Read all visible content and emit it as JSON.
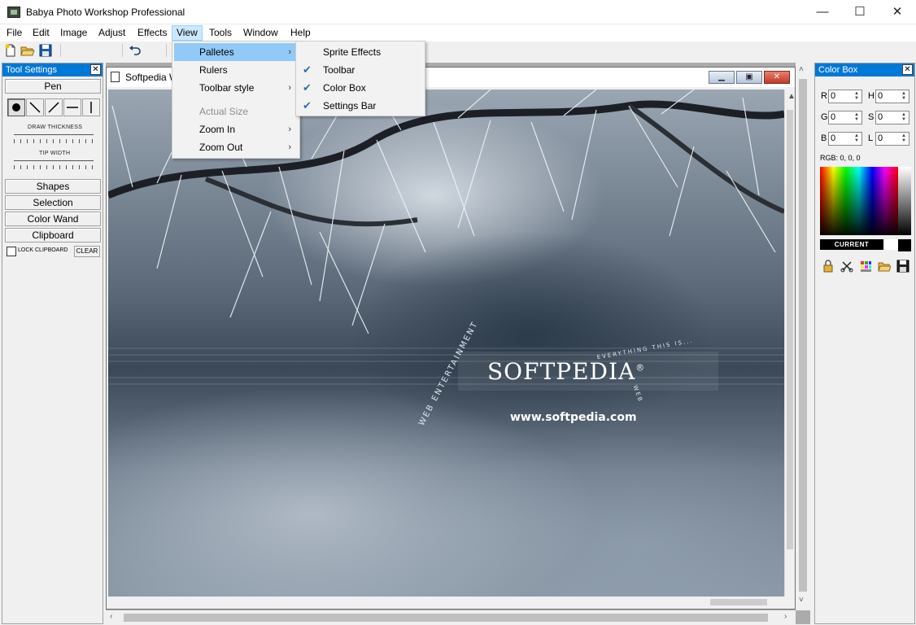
{
  "window": {
    "title": "Babya Photo Workshop Professional",
    "min": "—",
    "max": "☐",
    "close": "✕"
  },
  "menubar": [
    "File",
    "Edit",
    "Image",
    "Adjust",
    "Effects",
    "View",
    "Tools",
    "Window",
    "Help"
  ],
  "view_menu": {
    "items": [
      {
        "label": "Palletes",
        "submenu": true,
        "highlighted": true,
        "disabled": false
      },
      {
        "label": "Rulers",
        "submenu": false,
        "highlighted": false,
        "disabled": false
      },
      {
        "label": "Toolbar style",
        "submenu": true,
        "highlighted": false,
        "disabled": false
      },
      {
        "label": "Actual Size",
        "submenu": false,
        "highlighted": false,
        "disabled": true
      },
      {
        "label": "Zoom In",
        "submenu": true,
        "highlighted": false,
        "disabled": false
      },
      {
        "label": "Zoom Out",
        "submenu": true,
        "highlighted": false,
        "disabled": false
      }
    ],
    "arrow": "›"
  },
  "palletes_submenu": {
    "items": [
      {
        "label": "Sprite Effects",
        "checked": false
      },
      {
        "label": "Toolbar",
        "checked": true
      },
      {
        "label": "Color Box",
        "checked": true
      },
      {
        "label": "Settings Bar",
        "checked": true
      }
    ],
    "check": "✔"
  },
  "tool_settings": {
    "title": "Tool Settings",
    "close": "✕",
    "pen_label": "Pen",
    "draw_thickness": "DRAW THICKNESS",
    "tip_width": "TIP WIDTH",
    "buttons": [
      "Shapes",
      "Selection",
      "Color Wand",
      "Clipboard"
    ],
    "lock_clipboard": "LOCK CLIPBOARD",
    "clear": "CLEAR"
  },
  "document": {
    "title": "Softpedia W",
    "logo_text": "SOFTPEDIA",
    "logo_mark": "®",
    "url_text": "www.softpedia.com",
    "arc_text_1": "WEB ENTERTAINMENT",
    "arc_text_2": "EVERYTHING THIS IS...",
    "arc_text_3": "WEB"
  },
  "color_box": {
    "title": "Color Box",
    "close": "✕",
    "fields": [
      {
        "label": "R",
        "value": "0"
      },
      {
        "label": "H",
        "value": "0"
      },
      {
        "label": "G",
        "value": "0"
      },
      {
        "label": "S",
        "value": "0"
      },
      {
        "label": "B",
        "value": "0"
      },
      {
        "label": "L",
        "value": "0"
      }
    ],
    "rgb_readout": "RGB: 0, 0, 0",
    "current_label": "CURRENT",
    "current_color": "#000000"
  },
  "colors": {
    "accent": "#0078d7",
    "menu_highlight": "#91c9f7",
    "close_button": "#c0392b"
  }
}
